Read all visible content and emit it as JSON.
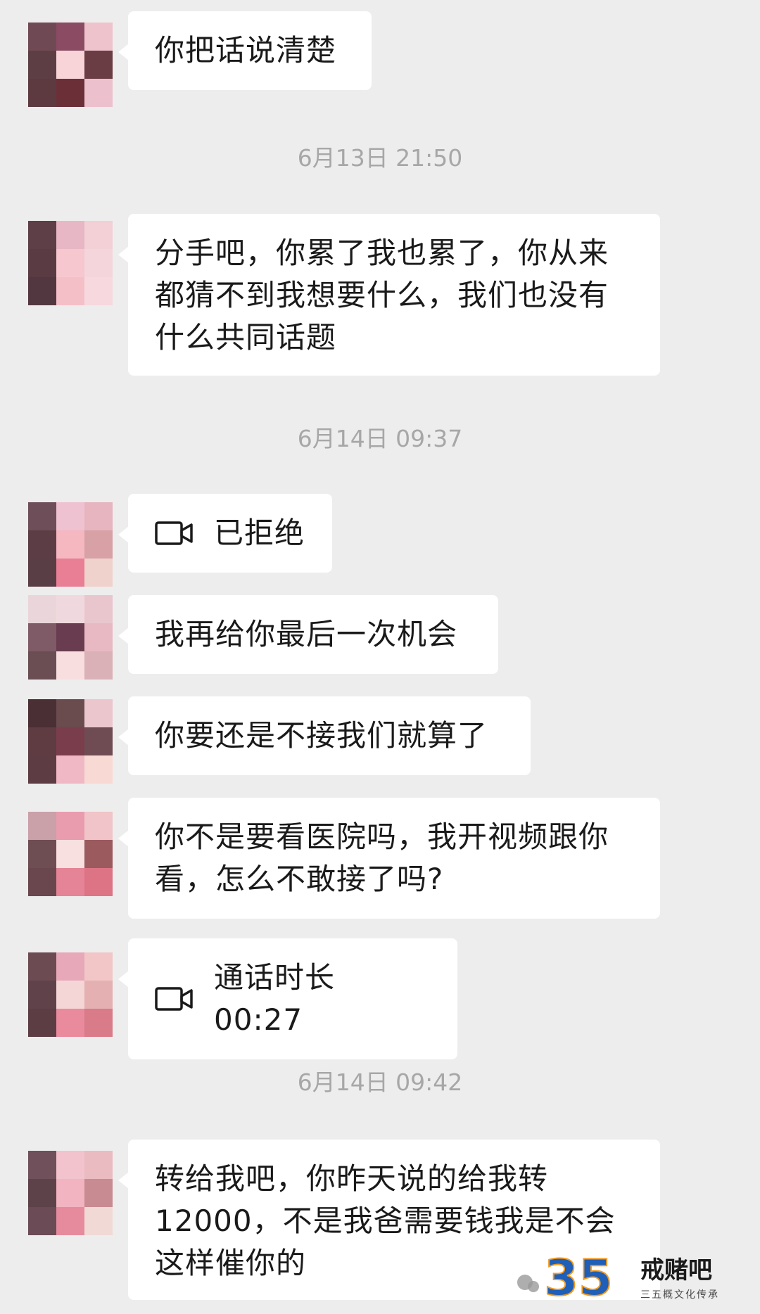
{
  "chat": {
    "m1": {
      "text": "你把话说清楚"
    },
    "t1": "6月13日 21:50",
    "m2": {
      "text": "分手吧，你累了我也累了，你从来都猜不到我想要什么，我们也没有什么共同话题"
    },
    "t2": "6月14日 09:37",
    "m3": {
      "icon": "video-camera-icon",
      "text": "已拒绝"
    },
    "m4": {
      "text": "我再给你最后一次机会"
    },
    "m5": {
      "text": "你要还是不接我们就算了"
    },
    "m6": {
      "text": "你不是要看医院吗，我开视频跟你看，怎么不敢接了吗?"
    },
    "m7": {
      "icon": "video-camera-icon",
      "text": "通话时长 00:27"
    },
    "t3": "6月14日 09:42",
    "m8": {
      "text": "转给我吧，你昨天说的给我转12000，不是我爸需要钱我是不会这样催你的"
    }
  },
  "watermark": {
    "number": "35",
    "title": "戒赌吧",
    "subtitle": "三五概文化传承"
  },
  "colors": {
    "background": "#ededed",
    "bubble": "#ffffff",
    "text": "#1a1a1a",
    "timestamp": "#a7a7a7",
    "watermark_blue": "#1f5fb8",
    "watermark_orange": "#f39a1e"
  },
  "avatars": [
    [
      "#6f4a54",
      "#8a4b63",
      "#efc3cc",
      "#5e3e45",
      "#f8d4d8",
      "#6a3c43",
      "#5d3a40",
      "#6b2f38",
      "#ecc0cc"
    ],
    [
      "#5e3e47",
      "#e8b7c6",
      "#f2d0d5",
      "#5a3b43",
      "#f7c7cf",
      "#f4d5dc",
      "#533740",
      "#f5bfc7",
      "#f7d8df"
    ],
    [
      "#6e4e58",
      "#efc2d1",
      "#e6b5bf",
      "#5c3d46",
      "#f5b7c0",
      "#d7a1a6",
      "#5a3e46",
      "#e97f94",
      "#f0d2cc"
    ],
    [
      "#ead6da",
      "#f0d9de",
      "#e9c6cd",
      "#7e5b66",
      "#6a3c50",
      "#e8b9c2",
      "#6b4d54",
      "#f8dede",
      "#d9b1b7"
    ],
    [
      "#4a2f35",
      "#6a4b4e",
      "#ecc6cd",
      "#5f3b42",
      "#7a3d4c",
      "#6f4c53",
      "#5d3c43",
      "#f0b8c4",
      "#f9d9d4"
    ],
    [
      "#caa0a9",
      "#e89cad",
      "#f0c4c8",
      "#6e4d53",
      "#f8dfe0",
      "#9b5a5e",
      "#6a474f",
      "#e58496",
      "#dc7486"
    ],
    [
      "#6c4b53",
      "#e7a9b9",
      "#f2c6c6",
      "#60434a",
      "#f5d6d7",
      "#e5b0b1",
      "#5c3d44",
      "#e98b9c",
      "#d97b89"
    ],
    [
      "#70505a",
      "#f2c3cd",
      "#eabcc2",
      "#5e424a",
      "#f2b4c0",
      "#c98b92",
      "#6b4b55",
      "#e58b9d",
      "#f1d9d6"
    ]
  ]
}
